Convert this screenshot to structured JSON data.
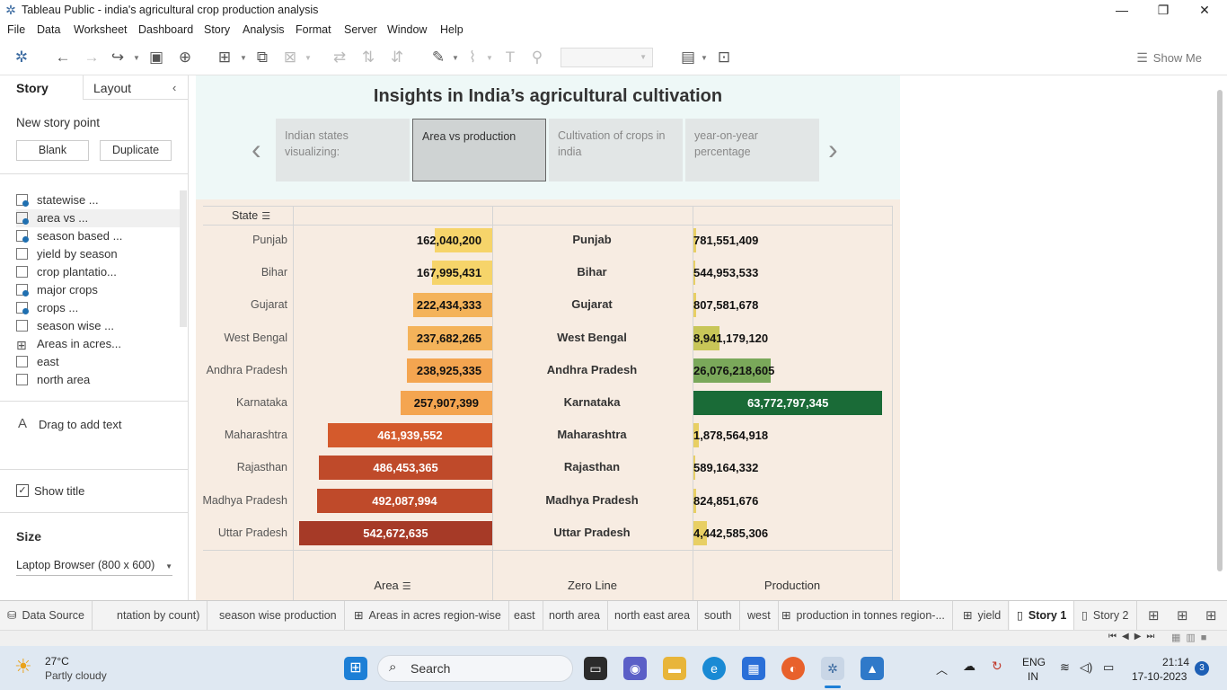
{
  "window": {
    "title": "Tableau Public - india's agricultural crop production analysis"
  },
  "menu": [
    "File",
    "Data",
    "Worksheet",
    "Dashboard",
    "Story",
    "Analysis",
    "Format",
    "Server",
    "Window",
    "Help"
  ],
  "toolbar": {
    "show_me": "Show Me"
  },
  "left_pane": {
    "tab_story": "Story",
    "tab_layout": "Layout",
    "new_story_point": "New story point",
    "blank_label": "Blank",
    "duplicate_label": "Duplicate",
    "sheets": [
      {
        "label": "statewise ...",
        "used": true
      },
      {
        "label": "area vs ...",
        "used": true,
        "selected": true
      },
      {
        "label": "season based ...",
        "used": true
      },
      {
        "label": "yield by season",
        "used": false
      },
      {
        "label": "crop plantatio...",
        "used": false
      },
      {
        "label": "major crops",
        "used": true
      },
      {
        "label": "crops ...",
        "used": true
      },
      {
        "label": "season wise ...",
        "used": false
      },
      {
        "label": "Areas in acres...",
        "used": false,
        "grid": true
      },
      {
        "label": "east",
        "used": false
      },
      {
        "label": "north area",
        "used": false
      }
    ],
    "drag_text": "Drag to add text",
    "show_title": "Show title",
    "size_heading": "Size",
    "size_value": "Laptop Browser (800 x 600)"
  },
  "story": {
    "title": "Insights in India’s agricultural cultivation",
    "points": [
      {
        "label": "Indian states visualizing:"
      },
      {
        "label": "Area vs production",
        "active": true
      },
      {
        "label": "Cultivation of crops in india"
      },
      {
        "label": "year-on-year percentage"
      }
    ]
  },
  "viz": {
    "row_header": "State",
    "col_area": "Area",
    "col_zero": "Zero Line",
    "col_production": "Production"
  },
  "chart_data": {
    "type": "bar",
    "categories": [
      "Punjab",
      "Bihar",
      "Gujarat",
      "West Bengal",
      "Andhra Pradesh",
      "Karnataka",
      "Maharashtra",
      "Rajasthan",
      "Madhya Pradesh",
      "Uttar Pradesh"
    ],
    "area": [
      162040200,
      167995431,
      222434333,
      237682265,
      238925335,
      257907399,
      461939552,
      486453365,
      492087994,
      542672635
    ],
    "area_labels": [
      "162,040,200",
      "167,995,431",
      "222,434,333",
      "237,682,265",
      "238,925,335",
      "257,907,399",
      "461,939,552",
      "486,453,365",
      "492,087,994",
      "542,672,635"
    ],
    "production": [
      781551409,
      544953533,
      807581678,
      8941179120,
      26076218605,
      63772797345,
      1878564918,
      589164332,
      824851676,
      4442585306
    ],
    "production_labels": [
      "781,551,409",
      "544,953,533",
      "807,581,678",
      "8,941,179,120",
      "26,076,218,605",
      "63,772,797,345",
      "1,878,564,918",
      "589,164,332",
      "824,851,676",
      "4,442,585,306"
    ],
    "area_colors": [
      "#f6d46a",
      "#f6d46a",
      "#f4b35a",
      "#f4b35a",
      "#f4a550",
      "#f4a550",
      "#d45a2c",
      "#bf4a2a",
      "#bf4a2a",
      "#a63a27"
    ],
    "production_colors": [
      "#e8cf64",
      "#e8cf64",
      "#e8cf64",
      "#c8c658",
      "#7aa85a",
      "#1a6b37",
      "#e8cf64",
      "#e8cf64",
      "#e8cf64",
      "#e8cf64"
    ]
  },
  "bottom_tabs": [
    {
      "label": "Data Source",
      "icon": "database-icon"
    },
    {
      "label": "ntation by count)"
    },
    {
      "label": "season wise production"
    },
    {
      "label": "Areas in acres region-wise",
      "icon": "grid-icon"
    },
    {
      "label": "east"
    },
    {
      "label": "north area"
    },
    {
      "label": "north east area"
    },
    {
      "label": "south"
    },
    {
      "label": "west"
    },
    {
      "label": "production in tonnes region-...",
      "icon": "grid-icon"
    },
    {
      "label": "yield",
      "icon": "grid-icon"
    },
    {
      "label": "Story 1",
      "icon": "book-icon",
      "active": true
    },
    {
      "label": "Story 2",
      "icon": "book-icon"
    }
  ],
  "taskbar": {
    "weather_temp": "27°C",
    "weather_desc": "Partly cloudy",
    "search_placeholder": "Search",
    "lang1": "ENG",
    "lang2": "IN",
    "time": "21:14",
    "date": "17-10-2023",
    "notif_count": "3"
  }
}
